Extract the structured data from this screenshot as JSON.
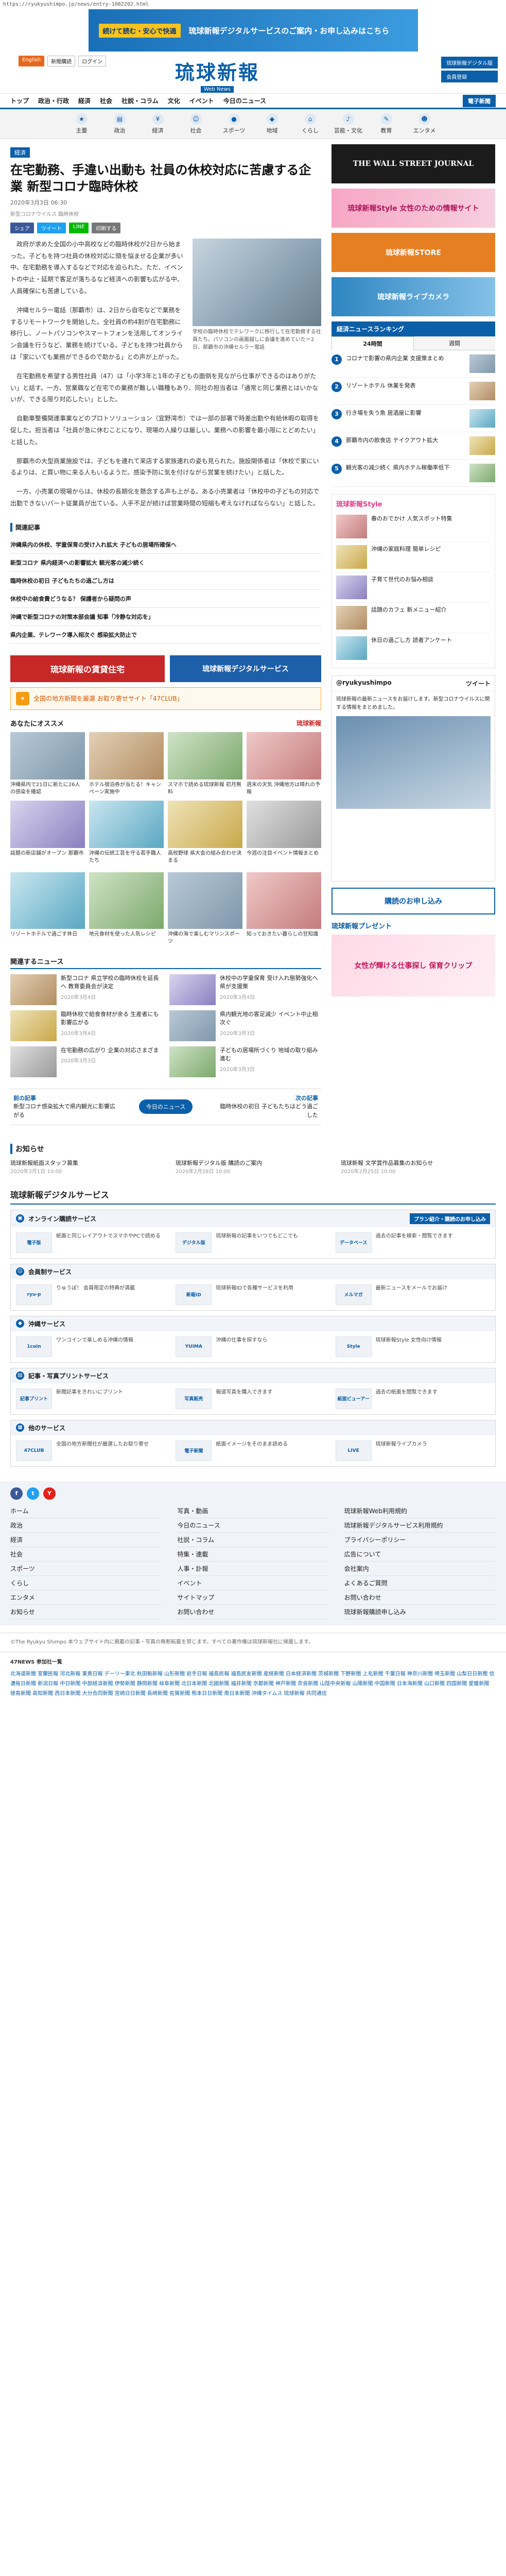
{
  "url": "https://ryukyushimpo.jp/news/entry-1082202.html",
  "top_banner": {
    "tag": "続けて読む・安心で快適",
    "text": "琉球新報デジタルサービスのご案内・お申し込みはこちら"
  },
  "header": {
    "lang_label": "English",
    "top_links": [
      "新聞購読",
      "ログイン"
    ],
    "logo_jp": "琉球新報",
    "logo_en": "Web News",
    "right_buttons": [
      "琉球新報デジタル版",
      "会員登録"
    ]
  },
  "global_nav": [
    "トップ",
    "政治・行政",
    "経済",
    "社会",
    "社説・コラム",
    "文化",
    "イベント",
    "今日のニュース"
  ],
  "global_nav_sub": "電子新聞",
  "category_nav": [
    "主要",
    "政治",
    "経済",
    "社会",
    "スポーツ",
    "地域",
    "くらし",
    "芸能・文化",
    "教育",
    "エンタメ"
  ],
  "article": {
    "category": "経済",
    "headline": "在宅勤務、手違い出動も 社員の休校対応に苦慮する企業 新型コロナ臨時休校",
    "date": "2020年3月3日 06:30",
    "byline": "新型コロナウイルス 臨時休校",
    "share": [
      "シェア",
      "ツイート",
      "LINE",
      "印刷する"
    ],
    "photo_caption": "学校の臨時休校でテレワークに移行して在宅勤務する社員たち。パソコンの画面越しに会議を進めていた＝2日、那覇市の沖縄セルラー電話",
    "paragraphs": [
      "政府が求めた全国の小中高校などの臨時休校が2日から始まった。子どもを持つ社員の休校対応に頭を悩ませる企業が多い中、在宅勤務を導入するなどで対応を迫られた。ただ、イベントの中止・延期で客足が落ちるなど経済への影響も広がる中、人員確保にも苦慮している。",
      "沖縄セルラー電話（那覇市）は、2日から自宅などで業務をするリモートワークを開始した。全社員の約4割が在宅勤務に移行し、ノートパソコンやスマートフォンを活用してオンライン会議を行うなど、業務を続けている。子どもを持つ社員からは「家にいても業務ができるので助かる」との声が上がった。",
      "在宅勤務を希望する男性社員（47）は「小学3年と1年の子どもの面倒を見ながら仕事ができるのはありがたい」と話す。一方、営業職など在宅での業務が難しい職種もあり、同社の担当者は「通常と同じ業務とはいかないが、できる限り対応したい」とした。",
      "自動車整備関連事業などのプロトソリューション（宜野湾市）では一部の部署で時差出勤や有給休暇の取得を促した。担当者は「社員が急に休むことになり、現場の人繰りは厳しい。業務への影響を最小限にとどめたい」と話した。",
      "那覇市の大型商業施設では、子どもを連れて来店する家族連れの姿も見られた。施設関係者は「休校で家にいるよりは、と買い物に来る人もいるようだ。感染予防に気を付けながら営業を続けたい」と話した。",
      "一方、小売業の現場からは、休校の長期化を懸念する声も上がる。ある小売業者は「休校中の子どもの対応で出勤できないパート従業員が出ている。人手不足が続けば営業時間の短縮も考えなければならない」と話した。"
    ]
  },
  "related": {
    "title": "関連記事",
    "items": [
      "沖縄県内の休校、学童保育の受け入れ拡大 子どもの居場所確保へ",
      "新型コロナ 県内経済への影響拡大 観光客の減少続く",
      "臨時休校の初日 子どもたちの過ごし方は",
      "休校中の給食費どうなる？ 保護者から疑問の声",
      "沖縄で新型コロナの対策本部会議 知事「冷静な対応を」",
      "県内企業、テレワーク導入相次ぐ 感染拡大防止で"
    ]
  },
  "ads": {
    "left": "琉球新報の賃貸住宅",
    "right": "琉球新報デジタルサービス"
  },
  "promo_bar": "全国の地方新聞を厳選 お取り寄せサイト「47CLUB」",
  "recommend": {
    "title": "あなたにオススメ",
    "brand": "琉球新報",
    "cards": [
      "沖縄県内で21日に新たに26人の感染を確認",
      "ホテル宿泊券が当たる！キャンペーン実施中",
      "スマホで読める琉球新報 初月無料",
      "週末の天気 沖縄地方は晴れの予報",
      "話題の新店舗がオープン 那覇市",
      "沖縄の伝統工芸を守る若手職人たち",
      "高校野球 県大会の組み合わせ決まる",
      "今週の注目イベント情報まとめ"
    ],
    "wide_cards": [
      "リゾートホテルで過ごす休日",
      "地元食材を使った人気レシピ",
      "沖縄の海で楽しむマリンスポーツ",
      "知っておきたい暮らしの豆知識"
    ]
  },
  "recent": {
    "title": "関連するニュース",
    "items": [
      {
        "text": "新型コロナ 県立学校の臨時休校を延長へ 教育委員会が決定",
        "date": "2020年3月4日"
      },
      {
        "text": "休校中の学童保育 受け入れ態勢強化へ 県が支援策",
        "date": "2020年3月4日"
      },
      {
        "text": "臨時休校で給食食材が余る 生産者にも影響広がる",
        "date": "2020年3月4日"
      },
      {
        "text": "県内観光地の客足減少 イベント中止相次ぐ",
        "date": "2020年3月3日"
      },
      {
        "text": "在宅勤務の広がり 企業の対応さまざま",
        "date": "2020年3月3日"
      },
      {
        "text": "子どもの居場所づくり 地域の取り組み進む",
        "date": "2020年3月3日"
      }
    ]
  },
  "pager": {
    "prev_label": "前の記事",
    "prev_text": "新型コロナ感染拡大で県内観光に影響広がる",
    "center": "今日のニュース",
    "next_label": "次の記事",
    "next_text": "臨時休校の初日 子どもたちはどう過ごした"
  },
  "notice": {
    "title": "お知らせ",
    "items": [
      {
        "text": "琉球新報紙面スタッフ募集",
        "date": "2020年3月1日 10:00"
      },
      {
        "text": "琉球新報デジタル版 購読のご案内",
        "date": "2020年2月28日 10:00"
      },
      {
        "text": "琉球新報 文学賞作品募集のお知らせ",
        "date": "2020年2月25日 10:00"
      }
    ]
  },
  "services": {
    "title": "琉球新報デジタルサービス",
    "blocks": [
      {
        "name": "オンライン購読サービス",
        "button": "プラン紹介・購読のお申し込み",
        "items": [
          {
            "logo": "電子版",
            "desc": "紙面と同じレイアウトでスマホやPCで読める"
          },
          {
            "logo": "デジタル版",
            "desc": "琉球新報の記事をいつでもどこでも"
          },
          {
            "logo": "データベース",
            "desc": "過去の記事を検索・閲覧できます"
          }
        ]
      },
      {
        "name": "会員制サービス",
        "button": "",
        "items": [
          {
            "logo": "ryu-p",
            "desc": "りゅうぽ！ 会員限定の特典が満載"
          },
          {
            "logo": "新報ID",
            "desc": "琉球新報IDで各種サービスを利用"
          },
          {
            "logo": "メルマガ",
            "desc": "最新ニュースをメールでお届け"
          }
        ]
      },
      {
        "name": "沖縄サービス",
        "button": "",
        "items": [
          {
            "logo": "1coin",
            "desc": "ワンコインで楽しめる沖縄の情報"
          },
          {
            "logo": "YUIMA",
            "desc": "沖縄の仕事を探すなら"
          },
          {
            "logo": "Style",
            "desc": "琉球新報Style 女性向け情報"
          }
        ]
      },
      {
        "name": "記事・写真プリントサービス",
        "button": "",
        "items": [
          {
            "logo": "記事プリント",
            "desc": "新聞記事をきれいにプリント"
          },
          {
            "logo": "写真販売",
            "desc": "報道写真を購入できます"
          },
          {
            "logo": "紙面ビューアー",
            "desc": "過去の紙面を閲覧できます"
          }
        ]
      },
      {
        "name": "他のサービス",
        "button": "",
        "items": [
          {
            "logo": "47CLUB",
            "desc": "全国の地方新聞社が厳選したお取り寄せ"
          },
          {
            "logo": "電子新聞",
            "desc": "紙面イメージをそのまま読める"
          },
          {
            "logo": "LIVE",
            "desc": "琉球新報ライブカメラ"
          }
        ]
      }
    ]
  },
  "sidebar": {
    "banners": [
      "THE WALL STREET JOURNAL",
      "琉球新報Style 女性のための情報サイト",
      "琉球新報STORE",
      "琉球新報ライブカメラ"
    ],
    "ranking_title": "経済ニュースランキング",
    "ranking_tabs": [
      "24時間",
      "週間"
    ],
    "ranking": [
      "コロナで影響の県内企業 支援策まとめ",
      "リゾートホテル 休業を発表",
      "行き場を失う魚 居酒屋に影響",
      "那覇市内の飲食店 テイクアウト拡大",
      "観光客の減少続く 県内ホテル稼働率低下"
    ],
    "style_title": "琉球新報Style",
    "style_items": [
      "春のおでかけ 人気スポット特集",
      "沖縄の家庭料理 簡単レシピ",
      "子育て世代のお悩み相談",
      "話題のカフェ 新メニュー紹介",
      "休日の過ごし方 読者アンケート"
    ],
    "twitter_title": "ツイート",
    "twitter_handle": "@ryukyushimpo",
    "tweet": "琉球新報の最新ニュースをお届けします。新型コロナウイルスに関する情報をまとめました。",
    "subscribe": "購読のお申し込み",
    "gift_title": "琉球新報プレゼント",
    "gift_card": "女性が輝ける仕事探し 保育クリップ"
  },
  "footer": {
    "sns": [
      "f",
      "t",
      "Y"
    ],
    "links_col1": [
      "ホーム",
      "政治",
      "経済",
      "社会",
      "スポーツ",
      "くらし",
      "エンタメ",
      "お知らせ"
    ],
    "links_col2": [
      "写真・動画",
      "今日のニュース",
      "社説・コラム",
      "特集・連載",
      "人事・訃報",
      "イベント",
      "サイトマップ",
      "お問い合わせ"
    ],
    "links_col3": [
      "琉球新報Web利用規約",
      "琉球新報デジタルサービス利用規約",
      "プライバシーポリシー",
      "広告について",
      "会社案内",
      "よくあるご質問",
      "お問い合わせ",
      "琉球新報購読申し込み"
    ],
    "copyright": "©The Ryukyu Shimpo 本ウェブサイト内に掲載の記事・写真の無断転載を禁じます。すべての著作権は琉球新報社に帰属します。",
    "news47_title": "47NEWS 参加社一覧",
    "news47": "北海道新聞 室蘭民報 河北新報 東奥日報 デーリー東北 秋田魁新報 山形新聞 岩手日報 福島民報 福島民友新聞 産経新聞 日本経済新聞 茨城新聞 下野新聞 上毛新聞 千葉日報 神奈川新聞 埼玉新聞 山梨日日新聞 信濃毎日新聞 新潟日報 中日新聞 中部経済新聞 伊勢新聞 静岡新聞 岐阜新聞 北日本新聞 北國新聞 福井新聞 京都新聞 神戸新聞 奈良新聞 山陰中央新報 山陽新聞 中国新聞 日本海新聞 山口新聞 四国新聞 愛媛新聞 徳島新聞 高知新聞 西日本新聞 大分合同新聞 宮崎日日新聞 長崎新聞 佐賀新聞 熊本日日新聞 南日本新聞 沖縄タイムス 琉球新報 共同通信"
  }
}
